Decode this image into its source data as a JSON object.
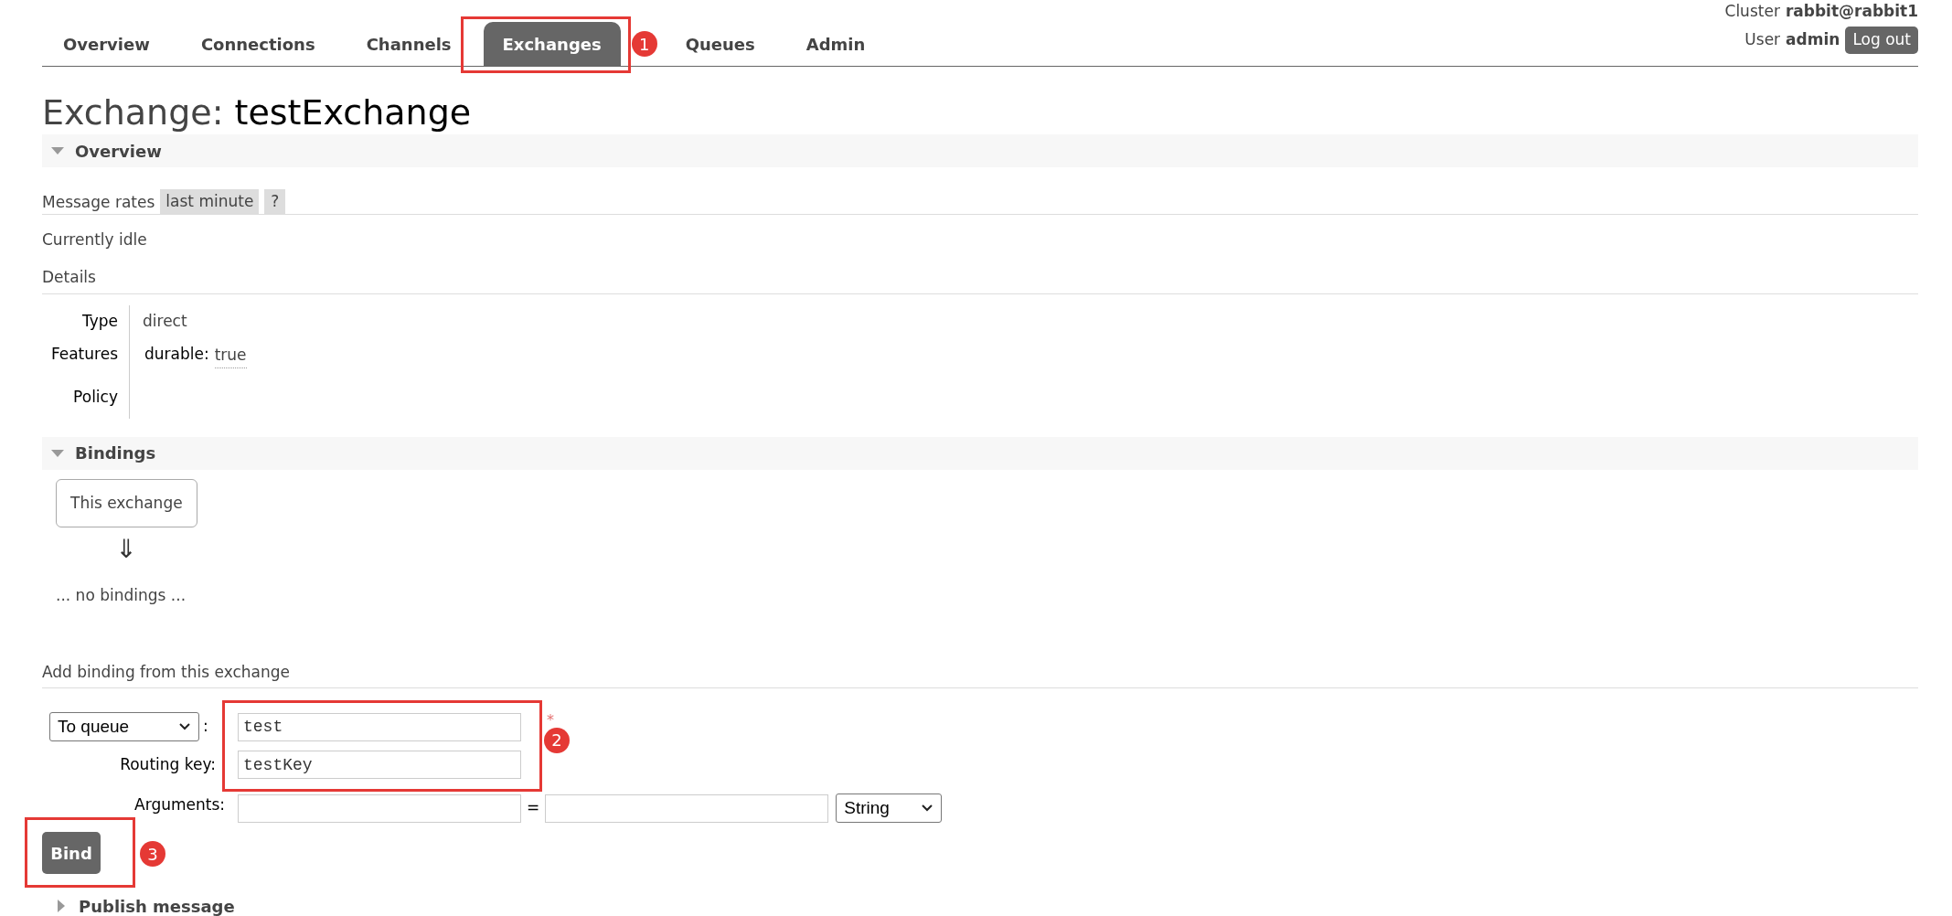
{
  "header": {
    "cluster_label": "Cluster",
    "cluster": "rabbit@rabbit1",
    "user_label": "User",
    "user": "admin",
    "logout": "Log out"
  },
  "tabs": [
    {
      "label": "Overview",
      "selected": false
    },
    {
      "label": "Connections",
      "selected": false
    },
    {
      "label": "Channels",
      "selected": false
    },
    {
      "label": "Exchanges",
      "selected": true
    },
    {
      "label": "Queues",
      "selected": false
    },
    {
      "label": "Admin",
      "selected": false
    }
  ],
  "title": {
    "prefix": "Exchange:",
    "name": "testExchange"
  },
  "overview": {
    "heading": "Overview",
    "expanded": true,
    "message_rates_label": "Message rates",
    "rate_range": "last minute",
    "help": "?",
    "status": "Currently idle",
    "details_heading": "Details",
    "details": [
      {
        "label": "Type",
        "value": "direct"
      },
      {
        "label": "Features",
        "key": "durable:",
        "value": "true"
      },
      {
        "label": "Policy"
      }
    ]
  },
  "bindings": {
    "heading": "Bindings",
    "expanded": true,
    "source": "This exchange",
    "arrow": "⇓",
    "empty": "... no bindings ..."
  },
  "add_binding": {
    "heading": "Add binding from this exchange",
    "destination_type": "To queue",
    "separator": ":",
    "destination": "test",
    "required_mark": "*",
    "routing_key_label": "Routing key:",
    "routing_key": "testKey",
    "arguments_label": "Arguments:",
    "equals": "=",
    "argument_type": "String",
    "button": "Bind"
  },
  "publish": {
    "heading": "Publish message",
    "expanded": false
  },
  "annotations": [
    {
      "number": "1"
    },
    {
      "number": "2"
    },
    {
      "number": "3"
    }
  ]
}
